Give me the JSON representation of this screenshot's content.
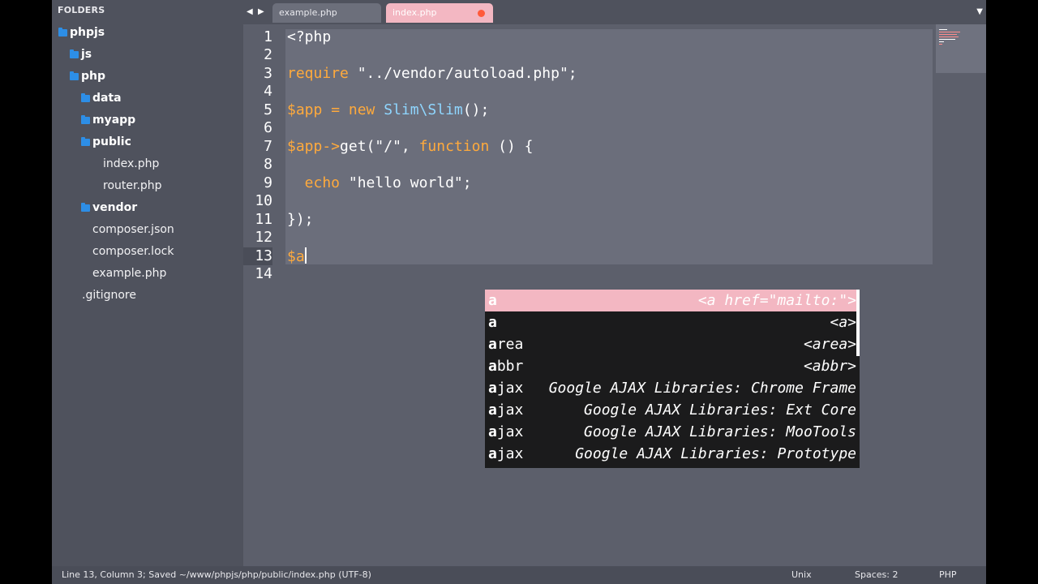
{
  "sidebar": {
    "title": "FOLDERS",
    "items": [
      {
        "label": "phpjs",
        "type": "folder"
      },
      {
        "label": "js",
        "type": "folder"
      },
      {
        "label": "php",
        "type": "folder"
      },
      {
        "label": "data",
        "type": "folder"
      },
      {
        "label": "myapp",
        "type": "folder"
      },
      {
        "label": "public",
        "type": "folder"
      },
      {
        "label": "index.php",
        "type": "file"
      },
      {
        "label": "router.php",
        "type": "file"
      },
      {
        "label": "vendor",
        "type": "folder"
      },
      {
        "label": "composer.json",
        "type": "file"
      },
      {
        "label": "composer.lock",
        "type": "file"
      },
      {
        "label": "example.php",
        "type": "file"
      },
      {
        "label": ".gitignore",
        "type": "file"
      }
    ]
  },
  "tabs": {
    "back_arrow": "◀",
    "forward_arrow": "▶",
    "items": [
      {
        "label": "example.php"
      },
      {
        "label": "index.php"
      }
    ],
    "menu_arrow": "▼"
  },
  "editor": {
    "line_numbers": [
      "1",
      "2",
      "3",
      "4",
      "5",
      "6",
      "7",
      "8",
      "9",
      "10",
      "11",
      "12",
      "13",
      "14"
    ],
    "code": {
      "l1": "<?php",
      "l3_kw": "require",
      "l3_str": " \"../vendor/autoload.php\";",
      "l5_var": "$app",
      "l5_op": " = ",
      "l5_kw": "new",
      "l5_cls": " Slim\\Slim",
      "l5_end": "();",
      "l7_var": "$app",
      "l7_arrow": "->",
      "l7_fn": "get",
      "l7_mid": "(\"/\", ",
      "l7_kw": "function",
      "l7_end": " () {",
      "l9_kw": "  echo",
      "l9_str": " \"hello world\";",
      "l11": "});",
      "l13": "$a"
    }
  },
  "autocomplete": {
    "items": [
      {
        "trigger_bold": "a",
        "trigger_rest": "",
        "description": "<a href=\"mailto:\">"
      },
      {
        "trigger_bold": "a",
        "trigger_rest": "",
        "description": "<a>"
      },
      {
        "trigger_bold": "a",
        "trigger_rest": "rea",
        "description": "<area>"
      },
      {
        "trigger_bold": "a",
        "trigger_rest": "bbr",
        "description": "<abbr>"
      },
      {
        "trigger_bold": "a",
        "trigger_rest": "jax",
        "description": "Google AJAX Libraries: Chrome Frame"
      },
      {
        "trigger_bold": "a",
        "trigger_rest": "jax",
        "description": "Google AJAX Libraries: Ext Core"
      },
      {
        "trigger_bold": "a",
        "trigger_rest": "jax",
        "description": "Google AJAX Libraries: MooTools"
      },
      {
        "trigger_bold": "a",
        "trigger_rest": "jax",
        "description": "Google AJAX Libraries: Prototype"
      }
    ]
  },
  "statusbar": {
    "position": "Line 13, Column 3; Saved ~/www/phpjs/php/public/index.php (UTF-8)",
    "line_endings": "Unix",
    "indentation": "Spaces: 2",
    "syntax": "PHP"
  },
  "colors": {
    "accent_pink": "#f3b7c2",
    "keyword_orange": "#ffaa3c",
    "class_blue": "#8fd6ff",
    "folder_blue": "#2d8ee6"
  }
}
